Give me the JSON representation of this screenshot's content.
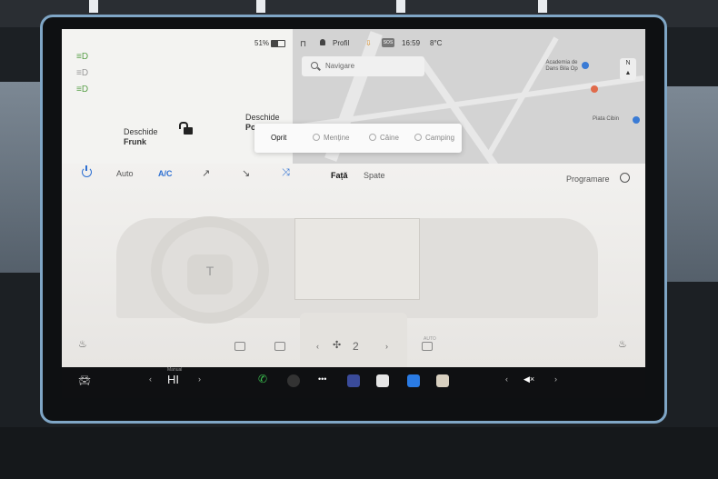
{
  "status_bar": {
    "battery": "51%",
    "profile": "Profil",
    "sos": "SOS",
    "time": "16:59",
    "temperature": "8°C"
  },
  "quick_controls": {
    "frunk_label_1": "Deschide",
    "frunk_label_2": "Frunk",
    "trunk_label_1": "Deschide",
    "trunk_label_2": "Po"
  },
  "map": {
    "search_placeholder": "Navigare",
    "poi_1": "Academia de",
    "poi_1b": "Dans Bila Op",
    "poi_2": "Piata Cibin",
    "compass": "N"
  },
  "keep_climate_menu": {
    "options": [
      "Oprit",
      "Menține",
      "Câine",
      "Camping"
    ],
    "selected": "Oprit"
  },
  "climate": {
    "auto": "Auto",
    "ac": "A/C",
    "front": "Față",
    "rear": "Spate",
    "schedule": "Programare",
    "fan_speed": "2",
    "rear_defrost_label": "AUTO"
  },
  "dock": {
    "temp_mode": "Manual",
    "driver_temp": "HI"
  },
  "colors": {
    "accent_blue": "#2d6fd2",
    "status_green": "#5aa04a",
    "dock_background": "#0f1012"
  }
}
